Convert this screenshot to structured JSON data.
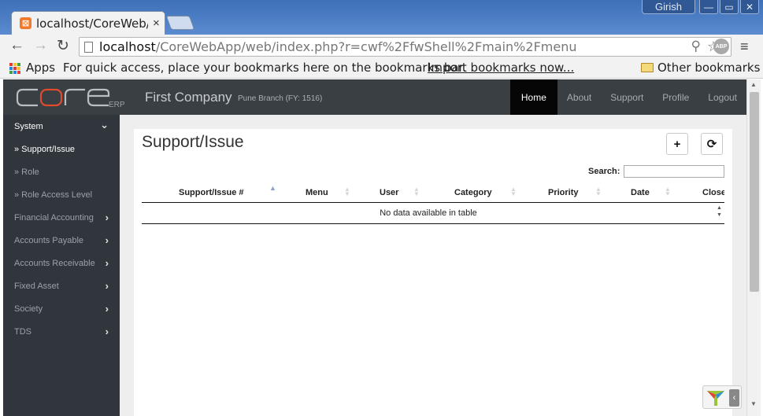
{
  "browser": {
    "tab_title": "localhost/CoreWeb/",
    "tab_close": "×",
    "window_user": "Girish",
    "url_host": "localhost",
    "url_path": "/CoreWebApp/web/index.php?r=cwf%2FfwShell%2Fmain%2Fmenu",
    "abp_label": "ABP",
    "bookmarks": {
      "apps": "Apps",
      "hint": "For quick access, place your bookmarks here on the bookmarks bar.",
      "import": "Import bookmarks now...",
      "other": "Other bookmarks"
    }
  },
  "app": {
    "logo_text": "CORE",
    "logo_sub": "ERP",
    "company": "First Company",
    "branch": "Pune Branch (FY: 1516)",
    "nav": [
      {
        "label": "Home"
      },
      {
        "label": "About"
      },
      {
        "label": "Support"
      },
      {
        "label": "Profile"
      },
      {
        "label": "Logout"
      }
    ]
  },
  "sidebar": {
    "items": [
      {
        "label": "System",
        "chevron": "⌄"
      },
      {
        "label": "» Support/Issue"
      },
      {
        "label": "» Role"
      },
      {
        "label": "» Role Access Level"
      },
      {
        "label": "Financial Accounting",
        "chevron": "›"
      },
      {
        "label": "Accounts Payable",
        "chevron": "›"
      },
      {
        "label": "Accounts Receivable",
        "chevron": "›"
      },
      {
        "label": "Fixed Asset",
        "chevron": "›"
      },
      {
        "label": "Society",
        "chevron": "›"
      },
      {
        "label": "TDS",
        "chevron": "›"
      }
    ]
  },
  "main": {
    "title": "Support/Issue",
    "add_icon": "+",
    "refresh_icon": "⟳",
    "search_label": "Search:",
    "table": {
      "columns": [
        "Support/Issue #",
        "Menu",
        "User",
        "Category",
        "Priority",
        "Date",
        "Close"
      ],
      "sorted_column": "Support/Issue #",
      "empty_message": "No data available in table"
    }
  }
}
